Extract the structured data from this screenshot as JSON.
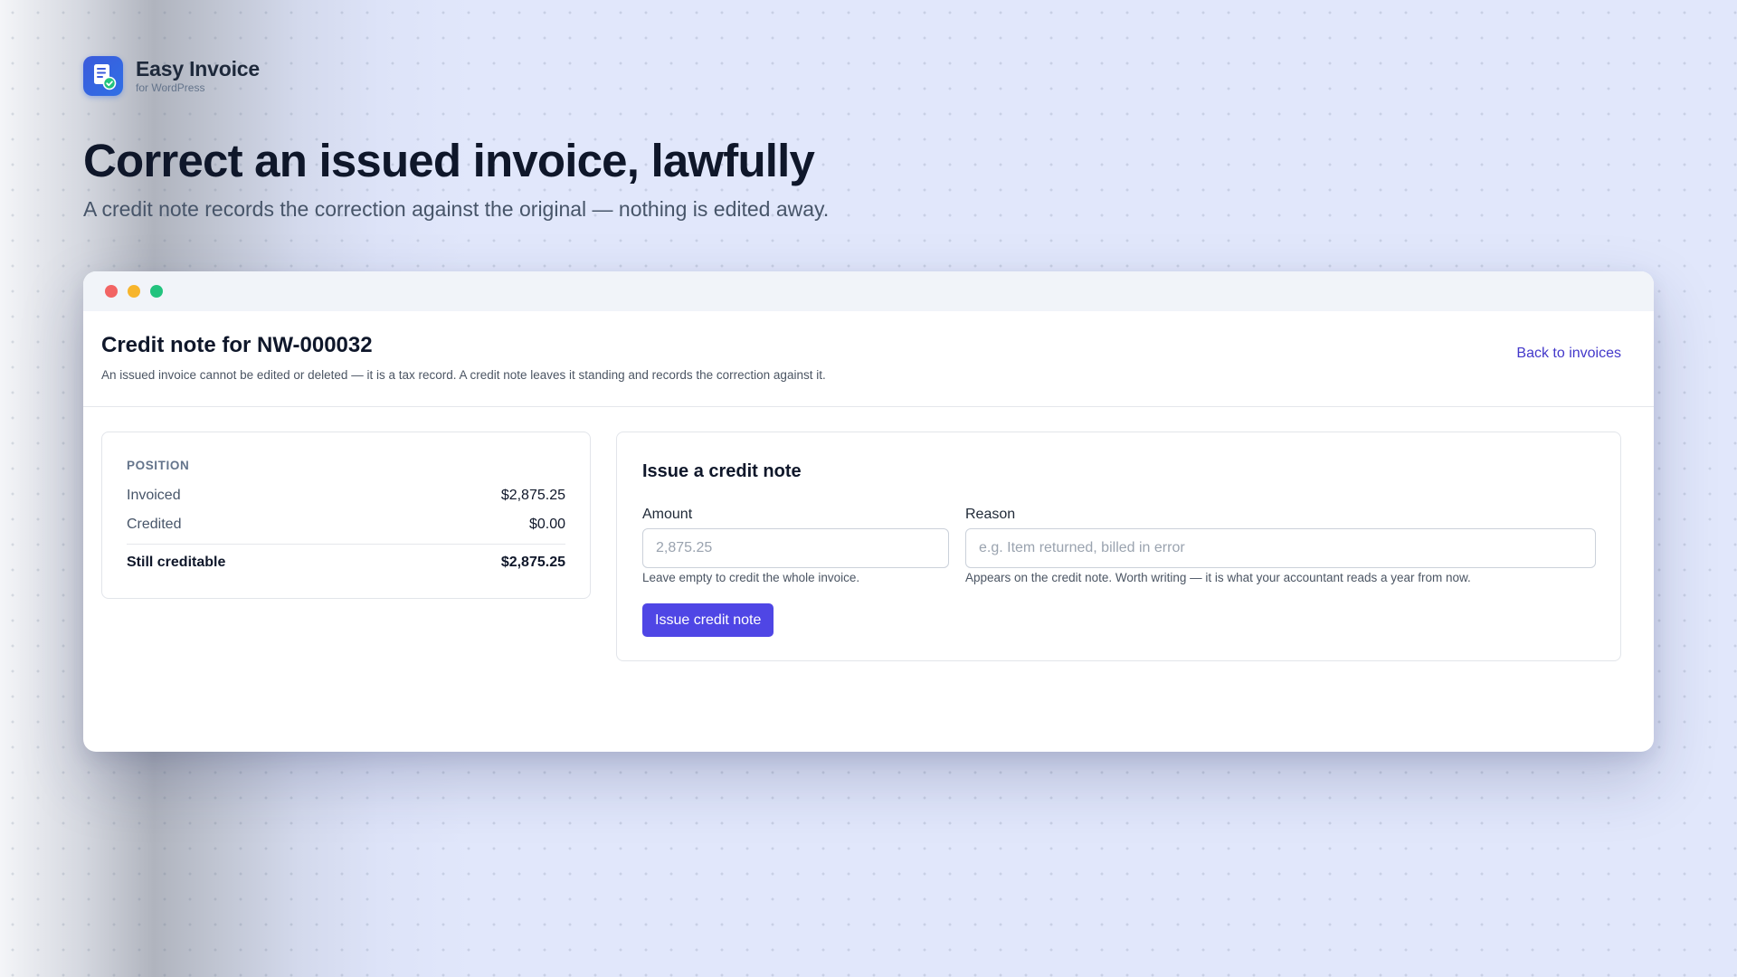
{
  "brand": {
    "name": "Easy Invoice",
    "subtitle": "for WordPress",
    "logo_icon": "invoice-document-check-icon"
  },
  "hero": {
    "title": "Correct an issued invoice, lawfully",
    "subtitle": "A credit note records the correction against the original — nothing is edited away."
  },
  "window_controls": [
    "close",
    "minimize",
    "maximize"
  ],
  "page": {
    "title": "Credit note for NW-000032",
    "description": "An issued invoice cannot be edited or deleted — it is a tax record. A credit note leaves it standing and records the correction against it.",
    "back_link": "Back to invoices"
  },
  "position": {
    "label": "POSITION",
    "rows": [
      {
        "label": "Invoiced",
        "value": "$2,875.25"
      },
      {
        "label": "Credited",
        "value": "$0.00"
      }
    ],
    "total": {
      "label": "Still creditable",
      "value": "$2,875.25"
    }
  },
  "issue": {
    "title": "Issue a credit note",
    "amount": {
      "label": "Amount",
      "value": "",
      "placeholder": "2,875.25",
      "hint": "Leave empty to credit the whole invoice."
    },
    "reason": {
      "label": "Reason",
      "value": "",
      "placeholder": "e.g. Item returned, billed in error",
      "hint": "Appears on the credit note. Worth writing — it is what your accountant reads a year from now."
    },
    "button": "Issue credit note"
  },
  "colors": {
    "accent": "#4f46e5",
    "link": "#4338ca",
    "dot_red": "#f26464",
    "dot_yellow": "#f7b52c",
    "dot_green": "#22c37e"
  }
}
